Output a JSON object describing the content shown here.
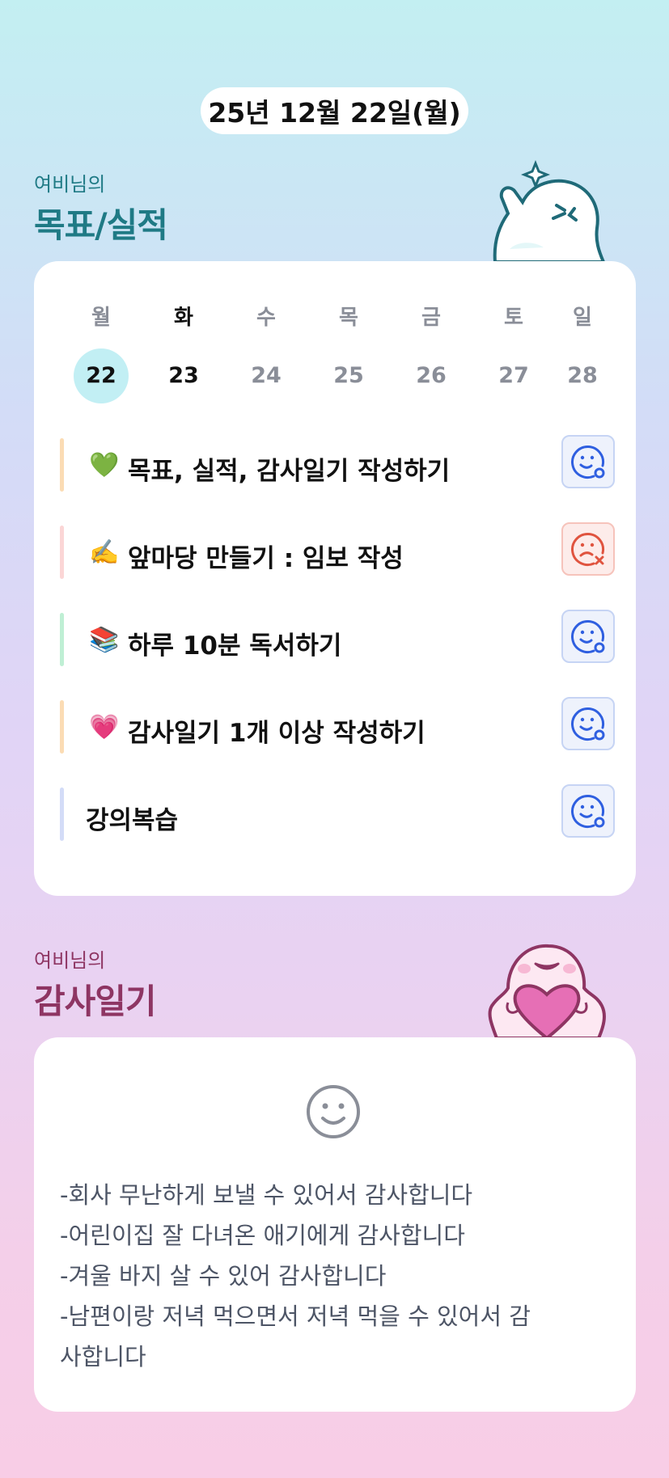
{
  "date": "25년 12월 22일(월)",
  "goals_section": {
    "subtitle": "여비님의",
    "title": "목표/실적"
  },
  "week": [
    {
      "day": "월",
      "date": "22"
    },
    {
      "day": "화",
      "date": "23"
    },
    {
      "day": "수",
      "date": "24"
    },
    {
      "day": "목",
      "date": "25"
    },
    {
      "day": "금",
      "date": "26"
    },
    {
      "day": "토",
      "date": "27"
    },
    {
      "day": "일",
      "date": "28"
    }
  ],
  "goals": [
    {
      "emoji": "💚",
      "label": "목표, 실적, 감사일기 작성하기",
      "bar_color": "#fbdcb4",
      "status": "success-face-icon"
    },
    {
      "emoji": "✍️",
      "label": "앞마당 만들기 : 임보 작성",
      "bar_color": "#fbd6d6",
      "status": "fail-face-icon"
    },
    {
      "emoji": "📚",
      "label": "하루 10분 독서하기",
      "bar_color": "#bfefd4",
      "status": "success-face-icon"
    },
    {
      "emoji": "💗",
      "label": "감사일기 1개 이상 작성하기",
      "bar_color": "#fbdcb4",
      "status": "success-face-icon"
    },
    {
      "emoji": "",
      "label": "강의복습",
      "bar_color": "#d3dcf7",
      "status": "success-face-icon"
    }
  ],
  "gratitude_section": {
    "subtitle": "여비님의",
    "title": "감사일기"
  },
  "gratitude_lines": [
    "-회사 무난하게 보낼 수 있어서 감사합니다",
    "-어린이집 잘 다녀온 애기에게 감사합니다",
    "-겨울 바지 살 수 있어 감사합니다",
    "-남편이랑 저녁 먹으면서 저녁 먹을 수 있어서 감",
    "사합니다"
  ],
  "colors": {
    "success": "#2f5fe0",
    "fail": "#e0543f",
    "goals_title": "#1f7a85",
    "gratitude_title": "#8e3563"
  }
}
